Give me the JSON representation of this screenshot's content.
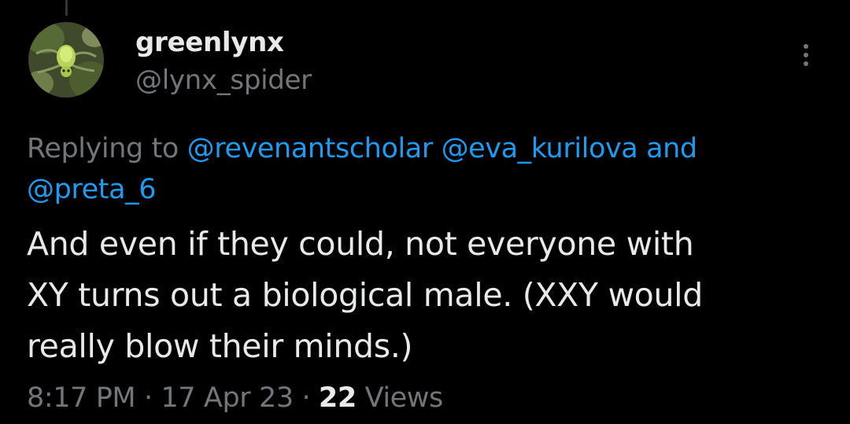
{
  "tweet": {
    "author": {
      "display_name": "greenlynx",
      "handle": "@lynx_spider",
      "avatar": "green-lynx-spider-photo"
    },
    "reply": {
      "prefix": "Replying to",
      "mentions": [
        "@revenantscholar",
        "@eva_kurilova"
      ],
      "joiner": "and",
      "last_mention": "@preta_6"
    },
    "text_lines": [
      "And even if they could, not everyone with",
      "XY turns out a biological male. (XXY would",
      "really blow their minds.)"
    ],
    "meta": {
      "time": "8:17 PM",
      "separator": "·",
      "date": "17 Apr 23",
      "views_count": "22",
      "views_label": "Views"
    },
    "menu_icon": "more-vertical-icon"
  },
  "colors": {
    "background": "#000000",
    "primary_text": "#e7e9ea",
    "secondary_text": "#71767b",
    "link": "#1d9bf0"
  }
}
